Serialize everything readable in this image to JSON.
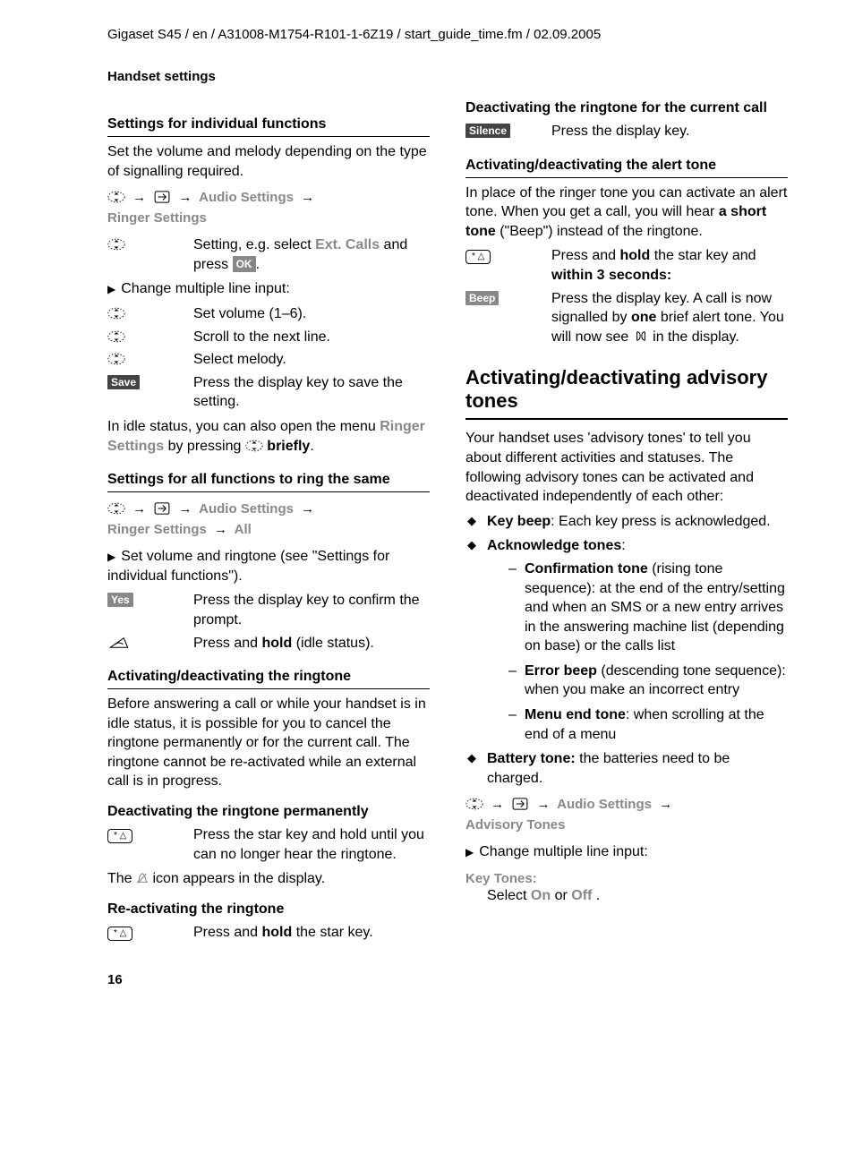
{
  "header": "Gigaset S45 / en / A31008-M1754-R101-1-6Z19 / start_guide_time.fm / 02.09.2005",
  "section_label": "Handset settings",
  "page_number": "16",
  "left": {
    "h_indiv": "Settings for individual functions",
    "p_indiv": "Set the volume and melody depending on the type of signalling required.",
    "nav1_audio": "Audio Settings",
    "nav1_ringer": "Ringer Settings",
    "step_setting_pre": "Setting, e.g. select ",
    "step_setting_bold": "Ext. Calls",
    "step_setting_post": " and press ",
    "ok": "OK",
    "change_line": "Change multiple line input:",
    "step_vol": "Set volume (1–6).",
    "step_scroll": "Scroll to the next line.",
    "step_melody": "Select melody.",
    "save": "Save",
    "step_save": "Press the display key to save the setting.",
    "idle_pre": "In idle status, you can also open the menu ",
    "idle_ringer": "Ringer Settings",
    "idle_mid": " by pressing ",
    "idle_briefly": "briefly",
    "h_all": "Settings for all functions to ring the same",
    "nav2_all": "All",
    "bullet_all": "Set volume and ringtone (see \"Settings for individual functions\").",
    "yes": "Yes",
    "step_yes": "Press the display key to confirm the prompt.",
    "step_hold_pre": "Press and ",
    "step_hold_bold": "hold",
    "step_hold_post": " (idle status).",
    "h_ringtone": "Activating/deactivating the ringtone",
    "p_ringtone": "Before answering a call or while your handset is in idle status, it is possible for you to cancel the ringtone permanently or for the current call. The ringtone cannot be re-activated while an external call is in progress.",
    "h_deact_perm": "Deactivating the ringtone permanently",
    "step_star_hold": "Press the star key and hold until you can no longer hear the ringtone.",
    "icon_line_pre": "The ",
    "icon_line_post": " icon appears in the display.",
    "h_react": "Re-activating the ringtone",
    "step_react_pre": "Press and ",
    "step_react_bold": "hold",
    "step_react_post": " the star key."
  },
  "right": {
    "h_deact_cur": "Deactivating the ringtone for the current call",
    "silence": "Silence",
    "step_silence": "Press the display key.",
    "h_alert": "Activating/deactivating the alert tone",
    "p_alert_pre": "In place of the ringer tone you can activate an alert tone. When you get a call, you will hear ",
    "p_alert_bold": "a short tone",
    "p_alert_post": " (\"Beep\") instead of the ringtone.",
    "step_star_pre": "Press and ",
    "step_star_bold": "hold",
    "step_star_mid": " the star key and ",
    "step_star_bold2": "within 3 seconds:",
    "beep": "Beep",
    "step_beep_pre": "Press the display key. A call is now signalled by ",
    "step_beep_bold": "one",
    "step_beep_post": " brief alert tone. You will now see ",
    "step_beep_end": " in the display.",
    "h_advisory": "Activating/deactivating advisory tones",
    "p_advisory": "Your handset uses 'advisory tones' to tell you about different activities and statuses. The following advisory tones can be activated and deactivated independently of each other:",
    "li_key_bold": "Key beep",
    "li_key": ": Each key press is acknowledged.",
    "li_ack_bold": "Acknowledge tones",
    "li_conf_bold": "Confirmation tone",
    "li_conf": " (rising tone sequence): at the end of the entry/setting and when an SMS or a new entry arrives in the answering machine list (depending on base) or the calls list",
    "li_err_bold": "Error beep",
    "li_err": " (descending tone sequence): when you make an incorrect entry",
    "li_menu_bold": "Menu end tone",
    "li_menu": ": when scrolling at the end of a menu",
    "li_batt_bold": "Battery tone:",
    "li_batt": " the batteries need to be charged.",
    "nav3_adv": "Advisory Tones",
    "change_line2": "Change multiple line input:",
    "key_tones": "Key Tones:",
    "select_pre": "Select ",
    "on": "On",
    "or": " or ",
    "off": "Off",
    "select_post": " ."
  }
}
